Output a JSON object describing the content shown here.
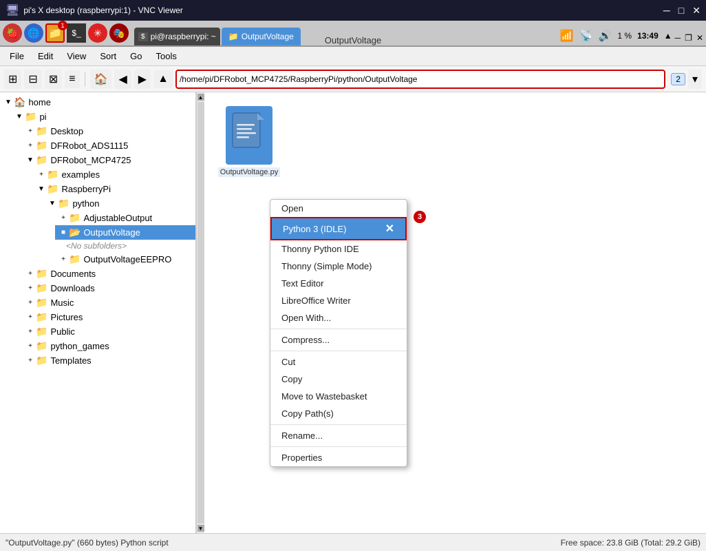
{
  "titleBar": {
    "title": "pi's X desktop (raspberrypi:1) - VNC Viewer",
    "minBtn": "─",
    "maxBtn": "□",
    "closeBtn": "✕"
  },
  "appHeader": {
    "tab1": "pi@raspberrypi: ~",
    "tab2": "OutputVoltage",
    "windowTitle": "OutputVoltage",
    "winMin": "─",
    "winRestore": "❐",
    "winClose": "✕"
  },
  "menuBar": {
    "items": [
      "File",
      "Edit",
      "View",
      "Sort",
      "Go",
      "Tools"
    ]
  },
  "toolbar": {
    "addressPath": "/home/pi/DFRobot_MCP4725/RaspberryPi/python/OutputVoltage",
    "addressBadge": "2"
  },
  "sidebar": {
    "items": [
      {
        "label": "home",
        "level": 0,
        "toggle": "▼",
        "icon": "🏠",
        "type": "home"
      },
      {
        "label": "pi",
        "level": 1,
        "toggle": "▼",
        "icon": "📁",
        "type": "folder"
      },
      {
        "label": "Desktop",
        "level": 2,
        "toggle": "+",
        "icon": "📁",
        "type": "folder"
      },
      {
        "label": "DFRobot_ADS1115",
        "level": 2,
        "toggle": "+",
        "icon": "📁",
        "type": "folder"
      },
      {
        "label": "DFRobot_MCP4725",
        "level": 2,
        "toggle": "▼",
        "icon": "📁",
        "type": "folder"
      },
      {
        "label": "examples",
        "level": 3,
        "toggle": "+",
        "icon": "📁",
        "type": "folder"
      },
      {
        "label": "RaspberryPi",
        "level": 3,
        "toggle": "▼",
        "icon": "📁",
        "type": "folder"
      },
      {
        "label": "python",
        "level": 4,
        "toggle": "▼",
        "icon": "📁",
        "type": "folder"
      },
      {
        "label": "AdjustableOutput",
        "level": 5,
        "toggle": "+",
        "icon": "📁",
        "type": "folder"
      },
      {
        "label": "OutputVoltage",
        "level": 5,
        "toggle": "■",
        "icon": "📂",
        "type": "folder-open",
        "selected": true
      },
      {
        "label": "<No subfolders>",
        "level": 6,
        "toggle": "",
        "icon": "",
        "type": "no-sub"
      },
      {
        "label": "OutputVoltageEEPRO",
        "level": 5,
        "toggle": "+",
        "icon": "📁",
        "type": "folder"
      },
      {
        "label": "Documents",
        "level": 2,
        "toggle": "+",
        "icon": "📁",
        "type": "folder"
      },
      {
        "label": "Downloads",
        "level": 2,
        "toggle": "+",
        "icon": "📁",
        "type": "folder"
      },
      {
        "label": "Music",
        "level": 2,
        "toggle": "+",
        "icon": "📁",
        "type": "folder"
      },
      {
        "label": "Pictures",
        "level": 2,
        "toggle": "+",
        "icon": "📁",
        "type": "folder"
      },
      {
        "label": "Public",
        "level": 2,
        "toggle": "+",
        "icon": "📁",
        "type": "folder"
      },
      {
        "label": "python_games",
        "level": 2,
        "toggle": "+",
        "icon": "📁",
        "type": "folder"
      },
      {
        "label": "Templates",
        "level": 2,
        "toggle": "+",
        "icon": "📁",
        "type": "folder"
      }
    ]
  },
  "fileArea": {
    "fileName": "OutputVoltage.py",
    "fileIcon": "📄"
  },
  "contextMenu": {
    "badge": "3",
    "items": [
      {
        "label": "Open",
        "type": "item"
      },
      {
        "label": "Python 3 (IDLE)",
        "type": "highlighted"
      },
      {
        "label": "Thonny Python IDE",
        "type": "item"
      },
      {
        "label": "Thonny (Simple Mode)",
        "type": "item"
      },
      {
        "label": "Text Editor",
        "type": "item"
      },
      {
        "label": "LibreOffice Writer",
        "type": "item"
      },
      {
        "label": "Open With...",
        "type": "item"
      },
      {
        "label": "sep1",
        "type": "separator"
      },
      {
        "label": "Compress...",
        "type": "item"
      },
      {
        "label": "sep2",
        "type": "separator"
      },
      {
        "label": "Cut",
        "type": "item"
      },
      {
        "label": "Copy",
        "type": "item"
      },
      {
        "label": "Move to Wastebasket",
        "type": "item"
      },
      {
        "label": "Copy Path(s)",
        "type": "item"
      },
      {
        "label": "sep3",
        "type": "separator"
      },
      {
        "label": "Rename...",
        "type": "item"
      },
      {
        "label": "sep4",
        "type": "separator"
      },
      {
        "label": "Properties",
        "type": "item"
      }
    ]
  },
  "statusBar": {
    "left": "\"OutputVoltage.py\" (660 bytes) Python script",
    "right": "Free space: 23.8 GiB (Total: 29.2 GiB)"
  },
  "systemTray": {
    "bluetooth": "⚡",
    "wifi": "📶",
    "volume": "🔊",
    "battery": "1 %",
    "time": "13:49"
  },
  "annotations": {
    "badge1": "1",
    "badge2": "2",
    "badge3": "3"
  }
}
